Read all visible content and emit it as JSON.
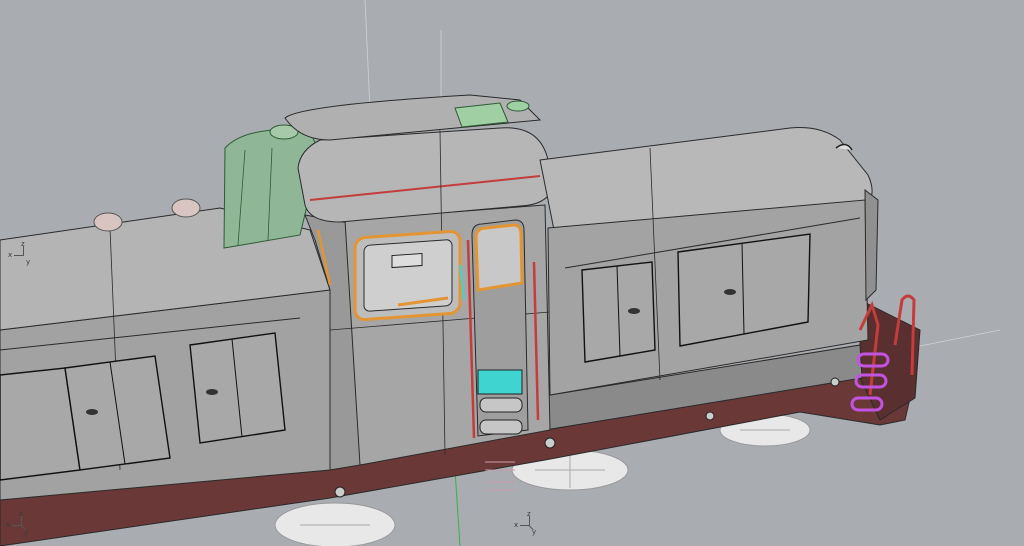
{
  "viewport": {
    "background": "#a9acb1",
    "gizmos": [
      {
        "x_label": "x",
        "y_label": "y",
        "z_label": "z"
      },
      {
        "x_label": "x",
        "y_label": "y",
        "z_label": "z"
      },
      {
        "x_label": "x",
        "y_label": "y",
        "z_label": "z"
      }
    ]
  },
  "colors": {
    "body": "#a2a2a2",
    "body_light": "#adadad",
    "wire": "#2a2a2a",
    "chassis": "#6b3838",
    "chassis_dark": "#4e2a2a",
    "selection_green": "#8fb797",
    "selection_orange": "#e49533",
    "curve_red": "#c43c3c",
    "selection_magenta": "#c254e0",
    "glass_cyan": "#3fd4d0",
    "wheel": "#e8e8e8"
  },
  "icons": [
    "axis-gizmo-icon"
  ]
}
